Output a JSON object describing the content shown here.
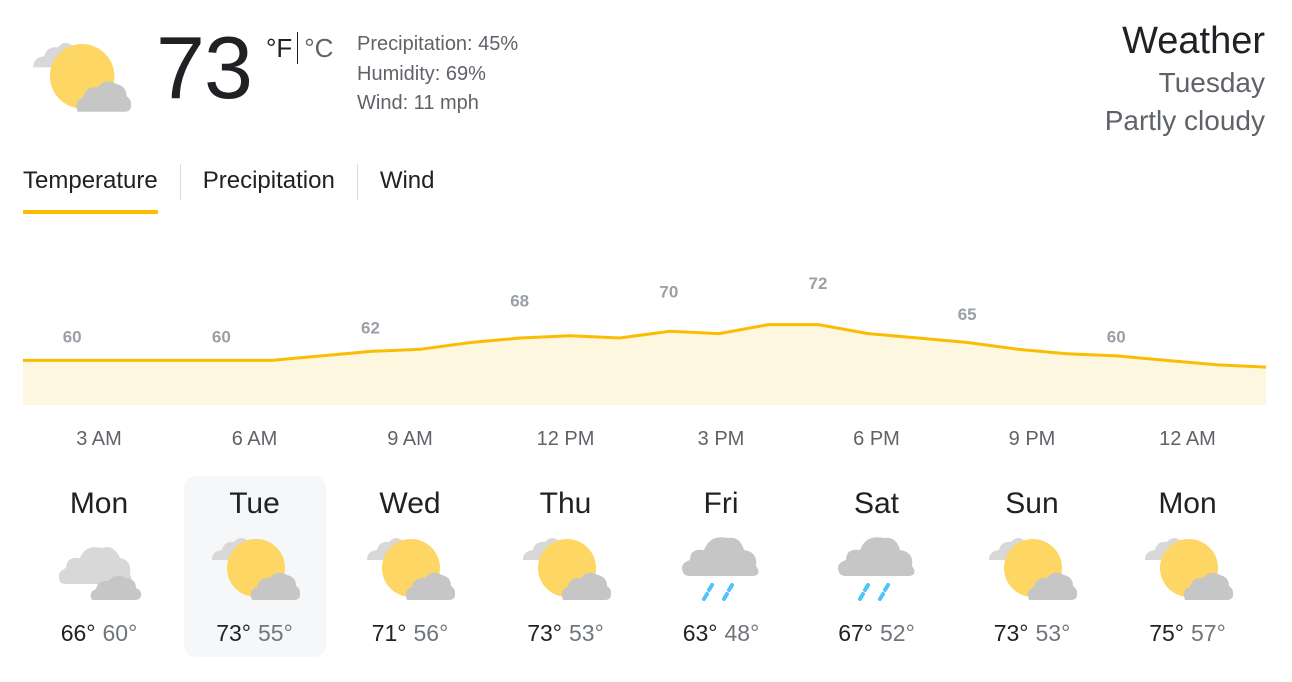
{
  "current": {
    "temp": "73",
    "unit_f": "°F",
    "unit_c": "°C",
    "condition_icon": "partly-cloudy-icon",
    "precipitation": "Precipitation: 45%",
    "humidity": "Humidity: 69%",
    "wind": "Wind: 11 mph"
  },
  "header": {
    "title": "Weather",
    "day": "Tuesday",
    "condition": "Partly cloudy"
  },
  "tabs": [
    {
      "label": "Temperature",
      "active": true
    },
    {
      "label": "Precipitation",
      "active": false
    },
    {
      "label": "Wind",
      "active": false
    }
  ],
  "chart_data": {
    "type": "area",
    "x": [
      "3 AM",
      "6 AM",
      "9 AM",
      "12 PM",
      "3 PM",
      "6 PM",
      "9 PM",
      "12 AM"
    ],
    "labeled_values": [
      60,
      60,
      62,
      68,
      70,
      72,
      65,
      60
    ],
    "hourly_values": [
      60,
      60,
      60,
      60,
      60,
      60,
      61,
      62,
      62.5,
      64,
      65,
      65.5,
      65,
      66.5,
      66,
      68,
      68,
      66,
      65,
      64,
      62.5,
      61.5,
      61,
      60,
      59,
      58.5
    ],
    "ylim": [
      50,
      78
    ],
    "line_color": "#fbbc04",
    "fill_color": "#fef7e0",
    "label_color": "#9aa0a6"
  },
  "forecast": [
    {
      "day": "Mon",
      "hi": "66°",
      "lo": "60°",
      "icon": "cloudy-icon"
    },
    {
      "day": "Tue",
      "hi": "73°",
      "lo": "55°",
      "icon": "partly-cloudy-icon",
      "selected": true
    },
    {
      "day": "Wed",
      "hi": "71°",
      "lo": "56°",
      "icon": "partly-cloudy-icon"
    },
    {
      "day": "Thu",
      "hi": "73°",
      "lo": "53°",
      "icon": "partly-cloudy-icon"
    },
    {
      "day": "Fri",
      "hi": "63°",
      "lo": "48°",
      "icon": "rain-icon"
    },
    {
      "day": "Sat",
      "hi": "67°",
      "lo": "52°",
      "icon": "rain-icon"
    },
    {
      "day": "Sun",
      "hi": "73°",
      "lo": "53°",
      "icon": "partly-cloudy-icon"
    },
    {
      "day": "Mon",
      "hi": "75°",
      "lo": "57°",
      "icon": "partly-cloudy-icon"
    }
  ]
}
